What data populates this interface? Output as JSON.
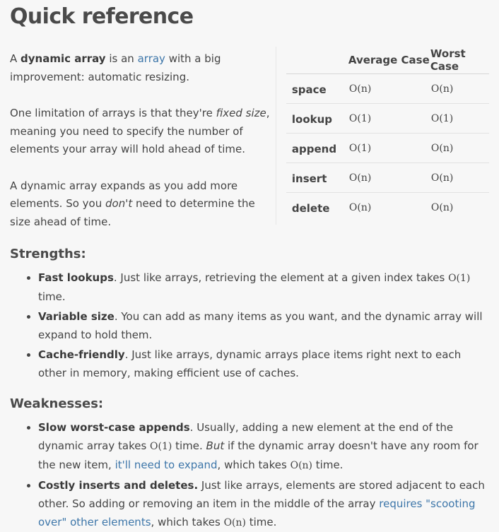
{
  "title": "Quick reference",
  "intro": {
    "p1": {
      "t1": "A ",
      "bold": "dynamic array",
      "t2": " is an ",
      "link": "array",
      "t3": " with a big improvement: automatic resizing."
    },
    "p2": {
      "t1": "One limitation of arrays is that they're ",
      "em": "fixed size",
      "t2": ", meaning you need to specify the number of elements your array will hold ahead of time."
    },
    "p3": {
      "t1": "A dynamic array expands as you add more elements. So you ",
      "em": "don't",
      "t2": " need to determine the size ahead of time."
    }
  },
  "complexity": {
    "headers": [
      "",
      "Average Case",
      "Worst Case"
    ],
    "rows": [
      {
        "op": "space",
        "avg": "O(n)",
        "worst": "O(n)"
      },
      {
        "op": "lookup",
        "avg": "O(1)",
        "worst": "O(1)"
      },
      {
        "op": "append",
        "avg": "O(1)",
        "worst": "O(n)"
      },
      {
        "op": "insert",
        "avg": "O(n)",
        "worst": "O(n)"
      },
      {
        "op": "delete",
        "avg": "O(n)",
        "worst": "O(n)"
      }
    ]
  },
  "strengths": {
    "heading": "Strengths:",
    "items": [
      {
        "bold": "Fast lookups",
        "t1": ". Just like arrays, retrieving the element at a given index takes ",
        "math": "O(1)",
        "t2": " time."
      },
      {
        "bold": "Variable size",
        "t1": ". You can add as many items as you want, and the dynamic array will expand to hold them."
      },
      {
        "bold": "Cache-friendly",
        "t1": ". Just like arrays, dynamic arrays place items right next to each other in memory, making efficient use of caches."
      }
    ]
  },
  "weaknesses": {
    "heading": "Weaknesses:",
    "items": [
      {
        "bold": "Slow worst-case appends",
        "t1": ". Usually, adding a new element at the end of the dynamic array takes ",
        "math1": "O(1)",
        "t2": " time. ",
        "em": "But",
        "t3": " if the dynamic array doesn't have any room for the new item, ",
        "link": "it'll need to expand",
        "t4": ", which takes ",
        "math2": "O(n)",
        "t5": " time."
      },
      {
        "bold": "Costly inserts and deletes.",
        "t1": " Just like arrays, elements are stored adjacent to each other. So adding or removing an item in the middle of the array ",
        "link": "requires \"scooting over\" other elements",
        "t2": ", which takes ",
        "math": "O(n)",
        "t3": " time."
      }
    ]
  }
}
